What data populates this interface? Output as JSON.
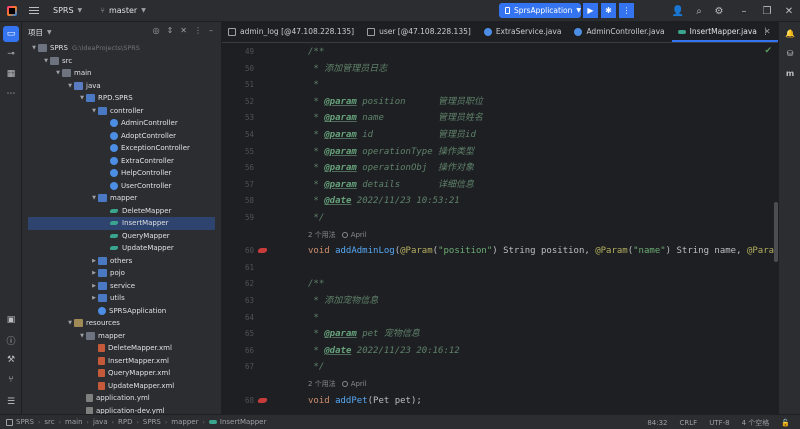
{
  "titlebar": {
    "project": "SPRS",
    "branch": "master",
    "run_config": "SprsApplication"
  },
  "project_panel": {
    "header": "项目",
    "tree": [
      {
        "label": "SPRS",
        "path": "G:\\IdeaProjects\\SPRS",
        "icon": "folder-icon",
        "depth": 0,
        "expanded": true
      },
      {
        "label": "src",
        "icon": "folder-icon",
        "depth": 1,
        "expanded": true
      },
      {
        "label": "main",
        "icon": "folder-icon",
        "depth": 2,
        "expanded": true
      },
      {
        "label": "java",
        "icon": "source-folder-icon",
        "depth": 3,
        "expanded": true
      },
      {
        "label": "RPD.SPRS",
        "icon": "package-icon",
        "depth": 4,
        "expanded": true
      },
      {
        "label": "controller",
        "icon": "package-icon",
        "depth": 5,
        "expanded": true
      },
      {
        "label": "AdminController",
        "icon": "class-icon",
        "depth": 6
      },
      {
        "label": "AdoptController",
        "icon": "class-icon",
        "depth": 6
      },
      {
        "label": "ExceptionController",
        "icon": "class-icon",
        "depth": 6
      },
      {
        "label": "ExtraController",
        "icon": "class-icon",
        "depth": 6
      },
      {
        "label": "HelpController",
        "icon": "class-icon",
        "depth": 6
      },
      {
        "label": "UserController",
        "icon": "class-icon",
        "depth": 6
      },
      {
        "label": "mapper",
        "icon": "package-icon",
        "depth": 5,
        "expanded": true
      },
      {
        "label": "DeleteMapper",
        "icon": "mapper-icon",
        "depth": 6
      },
      {
        "label": "InsertMapper",
        "icon": "mapper-icon",
        "depth": 6,
        "selected": true
      },
      {
        "label": "QueryMapper",
        "icon": "mapper-icon",
        "depth": 6
      },
      {
        "label": "UpdateMapper",
        "icon": "mapper-icon",
        "depth": 6
      },
      {
        "label": "others",
        "icon": "package-icon",
        "depth": 5,
        "expanded": false
      },
      {
        "label": "pojo",
        "icon": "package-icon",
        "depth": 5,
        "expanded": false
      },
      {
        "label": "service",
        "icon": "package-icon",
        "depth": 5,
        "expanded": false
      },
      {
        "label": "utils",
        "icon": "package-icon",
        "depth": 5,
        "expanded": false
      },
      {
        "label": "SPRSApplication",
        "icon": "app-class-icon",
        "depth": 5
      },
      {
        "label": "resources",
        "icon": "resources-folder-icon",
        "depth": 3,
        "expanded": true
      },
      {
        "label": "mapper",
        "icon": "folder-icon",
        "depth": 4,
        "expanded": true
      },
      {
        "label": "DeleteMapper.xml",
        "icon": "xml-icon",
        "depth": 5
      },
      {
        "label": "InsertMapper.xml",
        "icon": "xml-icon",
        "depth": 5
      },
      {
        "label": "QueryMapper.xml",
        "icon": "xml-icon",
        "depth": 5
      },
      {
        "label": "UpdateMapper.xml",
        "icon": "xml-icon",
        "depth": 5
      },
      {
        "label": "application.yml",
        "icon": "yml-icon",
        "depth": 4
      },
      {
        "label": "application-dev.yml",
        "icon": "yml-icon",
        "depth": 4
      }
    ]
  },
  "editor": {
    "tabs": [
      {
        "label": "admin_log [@47.108.228.135]",
        "icon": "db-table-icon"
      },
      {
        "label": "user [@47.108.228.135]",
        "icon": "db-table-icon"
      },
      {
        "label": "ExtraService.java",
        "icon": "class-icon"
      },
      {
        "label": "AdminController.java",
        "icon": "class-icon"
      },
      {
        "label": "InsertMapper.java",
        "icon": "mapper-icon",
        "active": true
      }
    ],
    "lines": [
      {
        "no": "49",
        "segs": [
          [
            "doc",
            "/**"
          ]
        ]
      },
      {
        "no": "50",
        "segs": [
          [
            "doc",
            " * 添加管理员日志"
          ]
        ]
      },
      {
        "no": "51",
        "segs": [
          [
            "doc",
            " *"
          ]
        ]
      },
      {
        "no": "52",
        "segs": [
          [
            "doc",
            " * "
          ],
          [
            "tag",
            "@param"
          ],
          [
            "param",
            " position      管理员职位"
          ]
        ]
      },
      {
        "no": "53",
        "segs": [
          [
            "doc",
            " * "
          ],
          [
            "tag",
            "@param"
          ],
          [
            "param",
            " name          管理员姓名"
          ]
        ]
      },
      {
        "no": "54",
        "segs": [
          [
            "doc",
            " * "
          ],
          [
            "tag",
            "@param"
          ],
          [
            "param",
            " id            管理员id"
          ]
        ]
      },
      {
        "no": "55",
        "segs": [
          [
            "doc",
            " * "
          ],
          [
            "tag",
            "@param"
          ],
          [
            "param",
            " operationType 操作类型"
          ]
        ]
      },
      {
        "no": "56",
        "segs": [
          [
            "doc",
            " * "
          ],
          [
            "tag",
            "@param"
          ],
          [
            "param",
            " operationObj  操作对象"
          ]
        ]
      },
      {
        "no": "57",
        "segs": [
          [
            "doc",
            " * "
          ],
          [
            "tag",
            "@param"
          ],
          [
            "param",
            " details       详细信息"
          ]
        ]
      },
      {
        "no": "58",
        "segs": [
          [
            "doc",
            " * "
          ],
          [
            "tag",
            "@date"
          ],
          [
            "doc",
            " 2022/11/23 10:53:21"
          ]
        ]
      },
      {
        "no": "59",
        "segs": [
          [
            "doc",
            " */"
          ]
        ]
      },
      {
        "no": "60",
        "gutter": true,
        "segs": [
          [
            "kw",
            "void "
          ],
          [
            "fn",
            "addAdminLog"
          ],
          [
            "plain",
            "("
          ],
          [
            "ann",
            "@Param"
          ],
          [
            "plain",
            "("
          ],
          [
            "str",
            "\"position\""
          ],
          [
            "plain",
            ") String position, "
          ],
          [
            "ann",
            "@Param"
          ],
          [
            "plain",
            "("
          ],
          [
            "str",
            "\"name\""
          ],
          [
            "plain",
            ") String name, "
          ],
          [
            "ann",
            "@Param"
          ]
        ]
      },
      {
        "no": "61",
        "segs": []
      },
      {
        "no": "62",
        "segs": [
          [
            "doc",
            "/**"
          ]
        ]
      },
      {
        "no": "63",
        "segs": [
          [
            "doc",
            " * 添加宠物信息"
          ]
        ]
      },
      {
        "no": "64",
        "segs": [
          [
            "doc",
            " *"
          ]
        ]
      },
      {
        "no": "65",
        "segs": [
          [
            "doc",
            " * "
          ],
          [
            "tag",
            "@param"
          ],
          [
            "param",
            " pet 宠物信息"
          ]
        ]
      },
      {
        "no": "66",
        "segs": [
          [
            "doc",
            " * "
          ],
          [
            "tag",
            "@date"
          ],
          [
            "doc",
            " 2022/11/23 20:16:12"
          ]
        ]
      },
      {
        "no": "67",
        "segs": [
          [
            "doc",
            " */"
          ]
        ]
      },
      {
        "no": "68",
        "gutter": true,
        "segs": [
          [
            "kw",
            "void "
          ],
          [
            "fn",
            "addPet"
          ],
          [
            "plain",
            "(Pet pet);"
          ]
        ]
      }
    ],
    "inlays": [
      {
        "usages": "2 个用法",
        "author": "April"
      },
      {
        "usages": "2 个用法",
        "author": "April"
      }
    ]
  },
  "statusbar": {
    "breadcrumbs": [
      "SPRS",
      "src",
      "main",
      "java",
      "RPD",
      "SPRS",
      "mapper",
      "InsertMapper"
    ],
    "position": "84:32",
    "line_ending": "CRLF",
    "encoding": "UTF-8",
    "indent": "4 个空格"
  }
}
